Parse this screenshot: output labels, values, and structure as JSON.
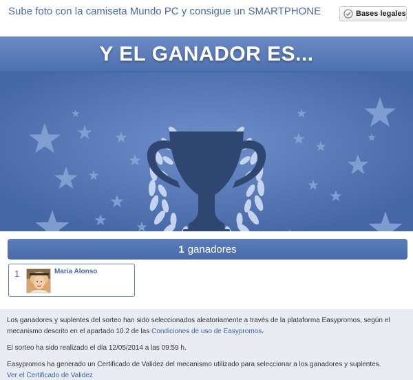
{
  "header": {
    "title": "Sube foto con la camiseta Mundo PC y consigue un SMARTPHONE",
    "legal_button": "Bases legales",
    "legal_icon": "check-circle-icon"
  },
  "banner": {
    "title": "Y EL GANADOR ES...",
    "art_icons": [
      "trophy-icon",
      "laurel-wreath-icon",
      "star-icon"
    ]
  },
  "winners": {
    "count": "1",
    "label": "ganadores",
    "list": [
      {
        "position": "1",
        "name": "Maria Alonso"
      }
    ]
  },
  "footer": {
    "paragraph1_text": "Los ganadores y suplentes del sorteo han sido seleccionados aleatoriamente a través de la plataforma Easypromos, según el mecanismo descrito en el apartado 10.2 de las ",
    "paragraph1_link": "Condiciones de uso de Easypromos",
    "paragraph1_end": ".",
    "paragraph2": "El sorteo ha sido realizado el día 12/05/2014 a las 09:59 h.",
    "paragraph3": "Easypromos ha generado un Certificado de Validez del mecanismo utilizado para seleccionar a los ganadores y suplentes.",
    "certificate_link": "Ver el Certificado de Validez"
  },
  "colors": {
    "accent": "#4a6aa3",
    "banner": "#4d70ae",
    "trophy": "#2e4670",
    "stars": "#8aa6d8"
  }
}
